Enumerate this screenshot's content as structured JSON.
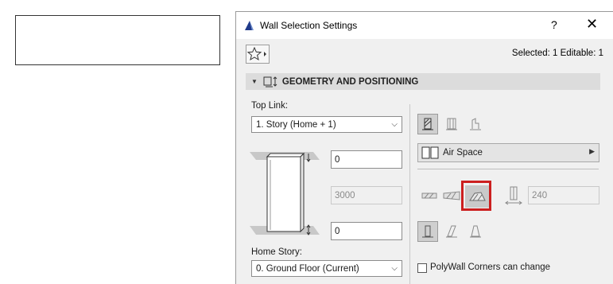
{
  "dialog": {
    "title": "Wall Selection Settings",
    "help_label": "?",
    "close_label": "✕",
    "selection_info": "Selected: 1 Editable: 1"
  },
  "section": {
    "title": "GEOMETRY AND POSITIONING",
    "expanded": true
  },
  "geometry": {
    "top_link_label": "Top Link:",
    "top_link_value": "1. Story (Home + 1)",
    "top_offset": "0",
    "height": "3000",
    "bottom_offset": "0",
    "home_story_label": "Home Story:",
    "home_story_value": "0. Ground Floor (Current)"
  },
  "structure": {
    "composite_name": "Air Space",
    "thickness": "240"
  },
  "options": {
    "polywall_label": "PolyWall Corners can change",
    "polywall_checked": false
  },
  "colors": {
    "highlight": "#cc1f1f",
    "title_icon": "#1f3a8a"
  }
}
